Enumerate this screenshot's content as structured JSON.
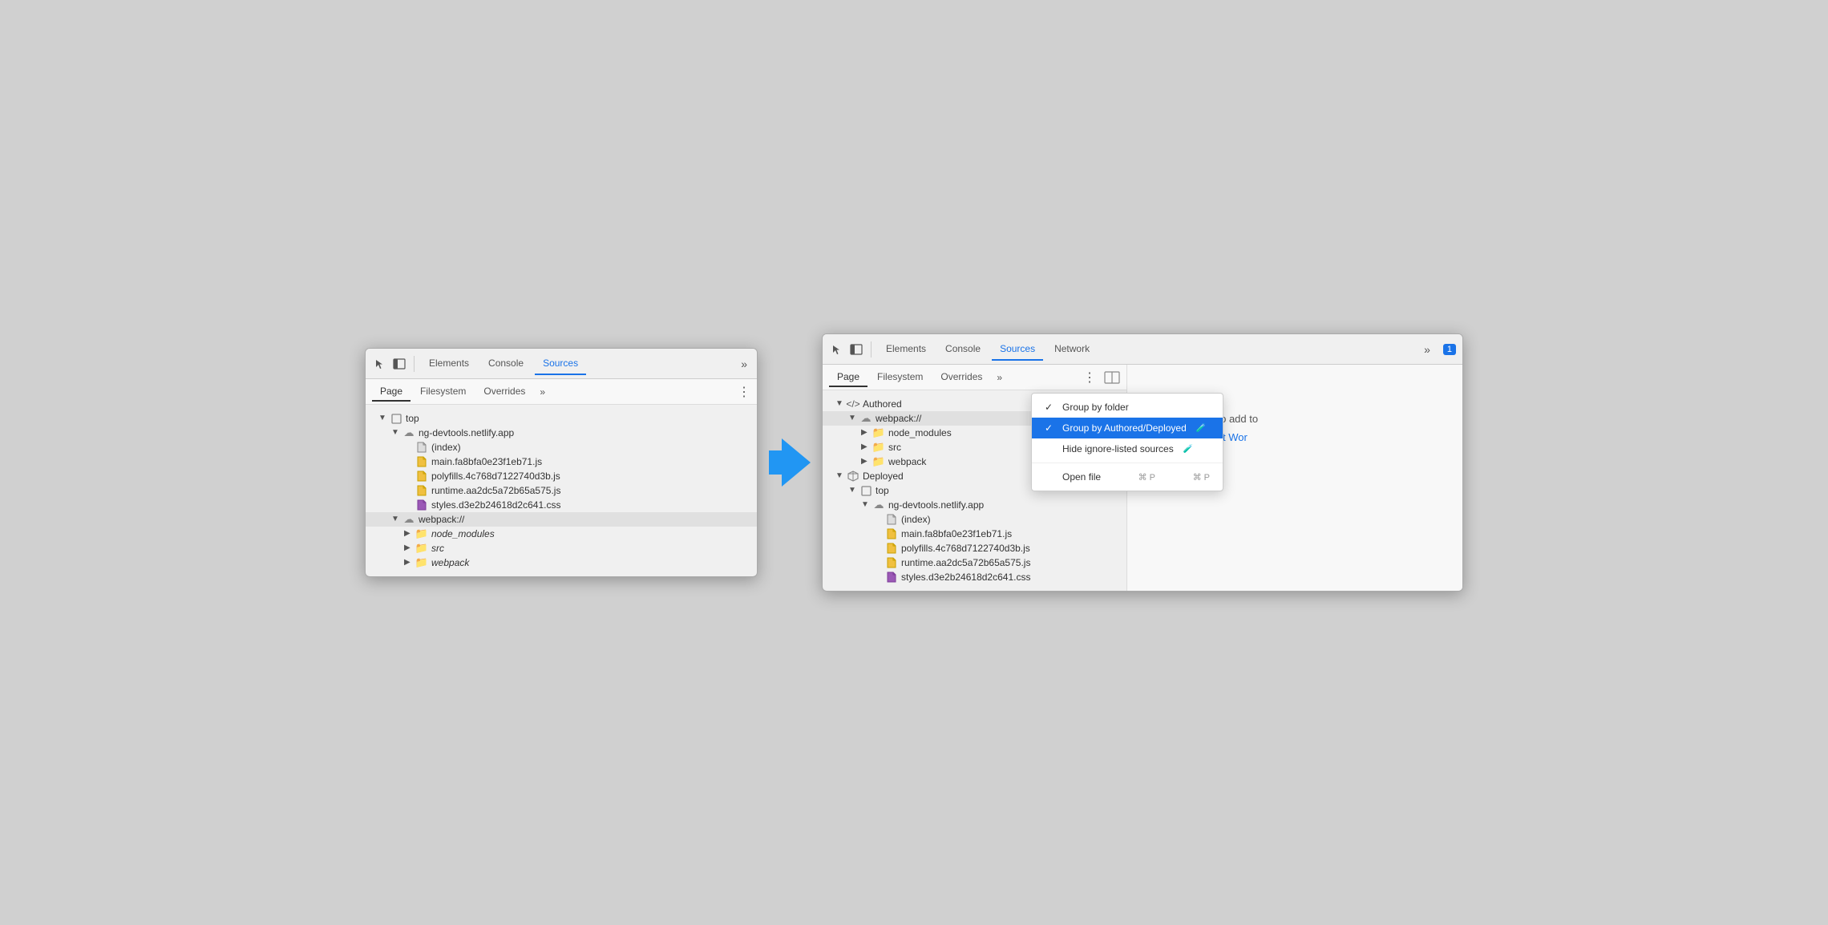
{
  "panel_left": {
    "tabs": [
      "Elements",
      "Console",
      "Sources"
    ],
    "active_tab": "Sources",
    "sec_tabs": [
      "Page",
      "Filesystem",
      "Overrides"
    ],
    "active_sec_tab": "Page",
    "tree": [
      {
        "id": "top",
        "label": "top",
        "icon": "square",
        "indent": 0,
        "arrow": "down"
      },
      {
        "id": "ng-devtools",
        "label": "ng-devtools.netlify.app",
        "icon": "cloud",
        "indent": 1,
        "arrow": "down"
      },
      {
        "id": "index",
        "label": "(index)",
        "icon": "file-white",
        "indent": 2,
        "arrow": "none"
      },
      {
        "id": "main",
        "label": "main.fa8bfa0e23f1eb71.js",
        "icon": "file-yellow",
        "indent": 2,
        "arrow": "none"
      },
      {
        "id": "polyfills",
        "label": "polyfills.4c768d7122740d3b.js",
        "icon": "file-yellow",
        "indent": 2,
        "arrow": "none"
      },
      {
        "id": "runtime",
        "label": "runtime.aa2dc5a72b65a575.js",
        "icon": "file-yellow",
        "indent": 2,
        "arrow": "none"
      },
      {
        "id": "styles",
        "label": "styles.d3e2b24618d2c641.css",
        "icon": "file-purple",
        "indent": 2,
        "arrow": "none"
      },
      {
        "id": "webpack-left",
        "label": "webpack://",
        "icon": "cloud",
        "indent": 1,
        "arrow": "down",
        "highlighted": true
      },
      {
        "id": "node_modules_l",
        "label": "node_modules",
        "icon": "folder-orange",
        "indent": 2,
        "arrow": "right",
        "italic": true
      },
      {
        "id": "src_l",
        "label": "src",
        "icon": "folder-orange",
        "indent": 2,
        "arrow": "right",
        "italic": true
      },
      {
        "id": "webpack_l",
        "label": "webpack",
        "icon": "folder-orange",
        "indent": 2,
        "arrow": "right",
        "italic": true
      }
    ]
  },
  "panel_right": {
    "tabs": [
      "Elements",
      "Console",
      "Sources",
      "Network"
    ],
    "active_tab": "Sources",
    "badge": "1",
    "sec_tabs": [
      "Page",
      "Filesystem",
      "Overrides"
    ],
    "active_sec_tab": "Page",
    "tree": [
      {
        "id": "authored",
        "label": "Authored",
        "icon": "code",
        "indent": 0,
        "arrow": "down"
      },
      {
        "id": "webpack-r",
        "label": "webpack://",
        "icon": "cloud",
        "indent": 1,
        "arrow": "down",
        "highlighted": true
      },
      {
        "id": "node_modules_r",
        "label": "node_modules",
        "icon": "folder-orange",
        "indent": 2,
        "arrow": "right"
      },
      {
        "id": "src_r",
        "label": "src",
        "icon": "folder-orange",
        "indent": 2,
        "arrow": "right"
      },
      {
        "id": "webpack_r",
        "label": "webpack",
        "icon": "folder-orange",
        "indent": 2,
        "arrow": "right"
      },
      {
        "id": "deployed",
        "label": "Deployed",
        "icon": "box",
        "indent": 0,
        "arrow": "down"
      },
      {
        "id": "top-r",
        "label": "top",
        "icon": "square",
        "indent": 1,
        "arrow": "down"
      },
      {
        "id": "ng-devtools-r",
        "label": "ng-devtools.netlify.app",
        "icon": "cloud",
        "indent": 2,
        "arrow": "down"
      },
      {
        "id": "index-r",
        "label": "(index)",
        "icon": "file-white",
        "indent": 3,
        "arrow": "none"
      },
      {
        "id": "main-r",
        "label": "main.fa8bfa0e23f1eb71.js",
        "icon": "file-yellow",
        "indent": 3,
        "arrow": "none"
      },
      {
        "id": "polyfills-r",
        "label": "polyfills.4c768d7122740d3b.js",
        "icon": "file-yellow",
        "indent": 3,
        "arrow": "none"
      },
      {
        "id": "runtime-r",
        "label": "runtime.aa2dc5a72b65a575.js",
        "icon": "file-yellow",
        "indent": 3,
        "arrow": "none"
      },
      {
        "id": "styles-r",
        "label": "styles.d3e2b24618d2c641.css",
        "icon": "file-purple",
        "indent": 3,
        "arrow": "none"
      }
    ],
    "context_menu": {
      "items": [
        {
          "label": "Group by folder",
          "check": true,
          "selected": false,
          "shortcut": ""
        },
        {
          "label": "Group by Authored/Deployed",
          "check": true,
          "selected": true,
          "shortcut": "",
          "experiment": true
        },
        {
          "label": "Hide ignore-listed sources",
          "check": false,
          "selected": false,
          "shortcut": "",
          "experiment": true
        },
        {
          "divider": true
        },
        {
          "label": "Open file",
          "check": false,
          "selected": false,
          "shortcut": "⌘ P"
        }
      ]
    },
    "filesystem_text": "Drop in a folder to add to",
    "filesystem_link": "Learn more about Wor"
  }
}
